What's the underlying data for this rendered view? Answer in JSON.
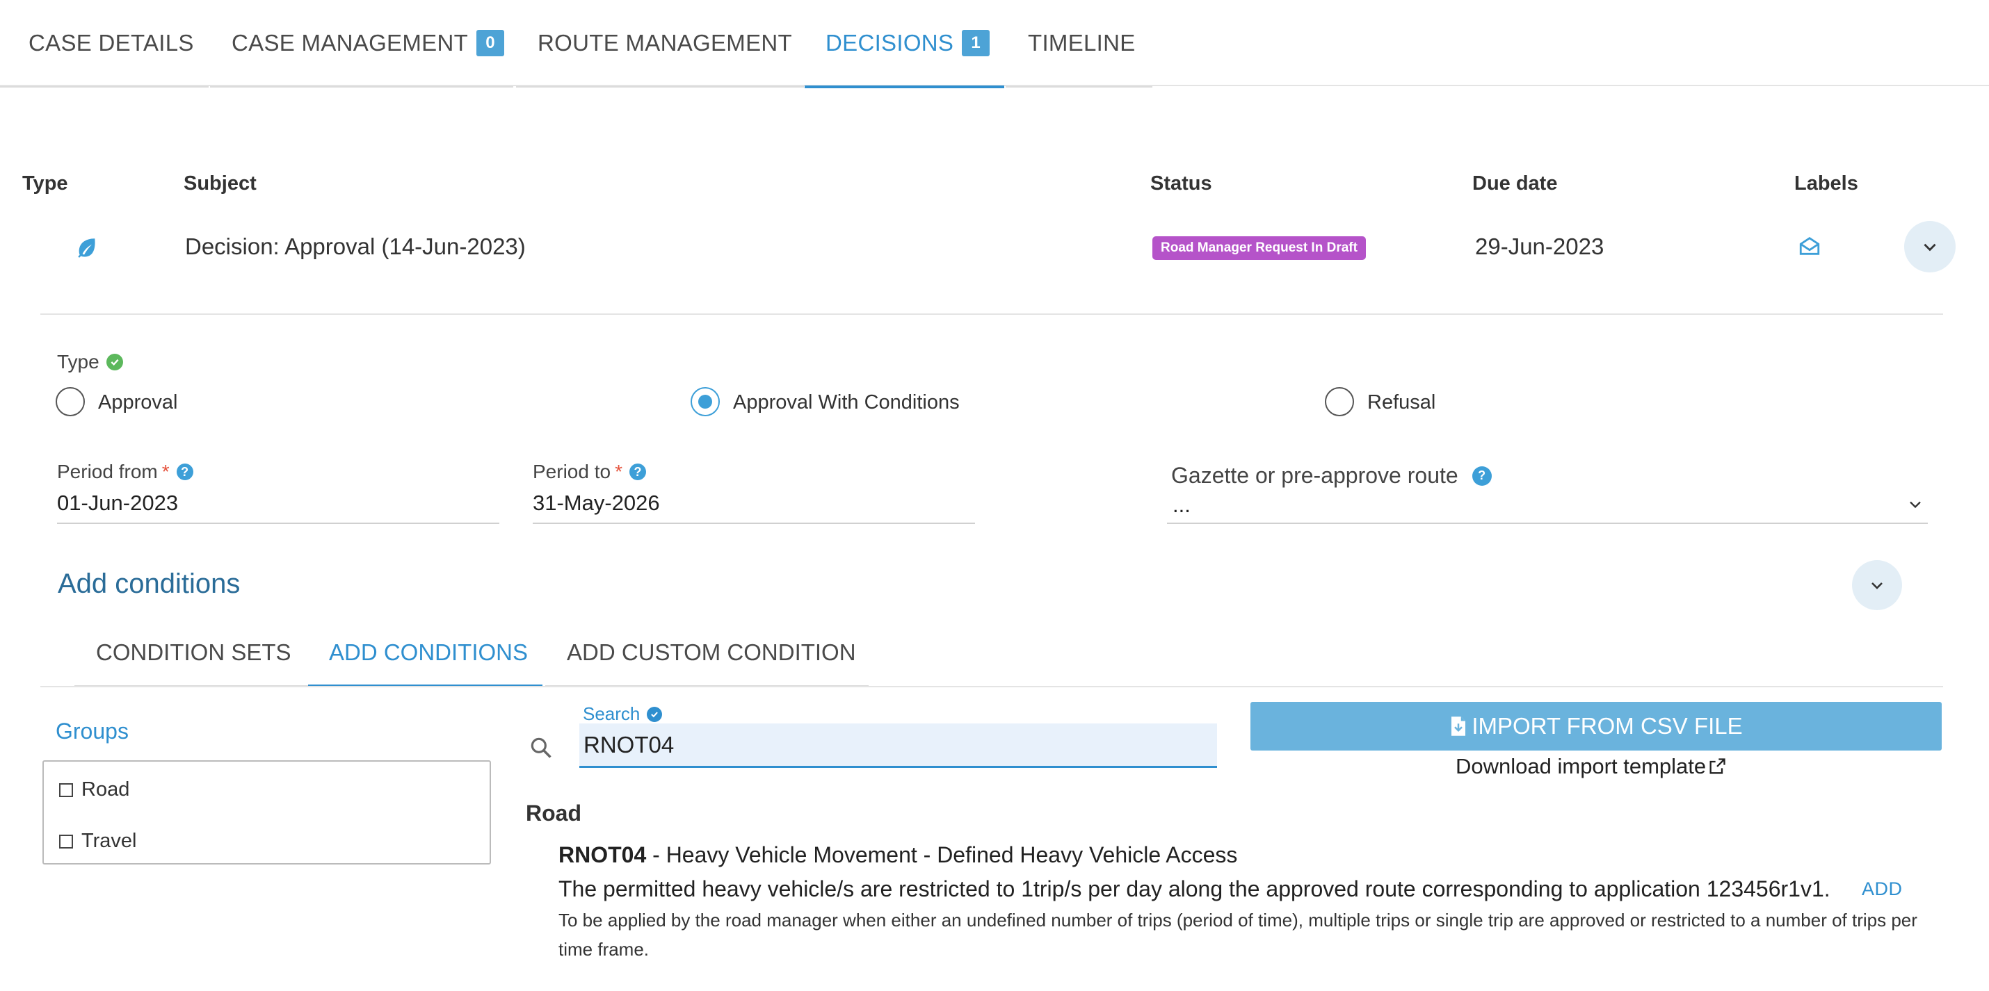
{
  "top_tabs": [
    {
      "label": "CASE DETAILS"
    },
    {
      "label": "CASE MANAGEMENT",
      "badge": "0"
    },
    {
      "label": "ROUTE MANAGEMENT"
    },
    {
      "label": "DECISIONS",
      "badge": "1",
      "active": true
    },
    {
      "label": "TIMELINE"
    }
  ],
  "table": {
    "headers": {
      "type": "Type",
      "subject": "Subject",
      "status": "Status",
      "due_date": "Due date",
      "labels": "Labels"
    },
    "row": {
      "type_icon": "leaf-icon",
      "subject": "Decision: Approval (14-Jun-2023)",
      "status": "Road Manager Request In Draft",
      "due_date": "29-Jun-2023",
      "labels_icon": "envelope-open-icon"
    }
  },
  "decision_form": {
    "type_label": "Type",
    "type_options": [
      "Approval",
      "Approval With Conditions",
      "Refusal"
    ],
    "type_selected": "Approval With Conditions",
    "period_from": {
      "label": "Period from",
      "value": "01-Jun-2023"
    },
    "period_to": {
      "label": "Period to",
      "value": "31-May-2026"
    },
    "gazette": {
      "label": "Gazette or pre-approve route",
      "value": "..."
    }
  },
  "conditions": {
    "title": "Add conditions",
    "tabs": [
      "CONDITION SETS",
      "ADD CONDITIONS",
      "ADD CUSTOM CONDITION"
    ],
    "active_tab": "ADD CONDITIONS",
    "groups_label": "Groups",
    "groups": [
      "Road",
      "Travel"
    ],
    "search_label": "Search",
    "search_value": "RNOT04",
    "import_button": "IMPORT FROM CSV FILE",
    "download_link": "Download import template",
    "result_group": "Road",
    "result": {
      "code": "RNOT04",
      "title": " - Heavy Vehicle Movement - Defined Heavy Vehicle Access",
      "text": "The permitted heavy vehicle/s are restricted to 1trip/s per day along the approved route corresponding to application 123456r1v1.",
      "note": "To be applied by the road manager when either an undefined number of trips (period of time), multiple trips or single trip are approved or restricted to a number of trips per time frame.",
      "add_label": "ADD"
    }
  },
  "colors": {
    "accent": "#2f8fcf",
    "status_badge": "#b553c9",
    "valid_check": "#5cb85c"
  }
}
